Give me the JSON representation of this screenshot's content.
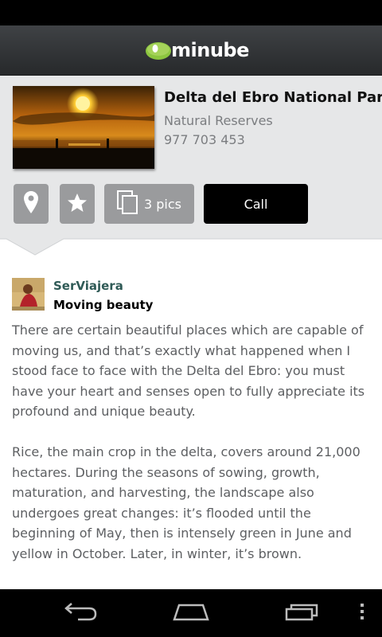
{
  "app": {
    "brand": "minube"
  },
  "place": {
    "name": "Delta del Ebro National Park",
    "category": "Natural Reserves",
    "phone": "977 703 453"
  },
  "actions": {
    "map_icon": "map-pin-icon",
    "favorite_icon": "star-icon",
    "pics_label": "3 pics",
    "call_label": "Call"
  },
  "review": {
    "author": "SerViajera",
    "title": "Moving beauty",
    "paragraphs": [
      "There are certain beautiful places which are capable of moving us, and that’s exactly what happened when I stood face to face with the Delta del Ebro: you must have your heart and senses open to fully appreciate its profound and unique beauty.",
      "Rice, the main crop in the delta, covers around 21,000 hectares. During the seasons of sowing, growth, maturation, and harvesting, the landscape also undergoes great changes: it’s flooded until the beginning of May, then is intensely green in June and yellow in October. Later, in winter, it’s brown."
    ]
  },
  "navigation": {
    "back_icon": "back-icon",
    "home_icon": "home-icon",
    "recents_icon": "recent-apps-icon",
    "menu_icon": "overflow-menu-icon"
  },
  "colors": {
    "brand_green": "#8cc63f",
    "author_color": "#2f5a56",
    "call_button": "#000000",
    "action_button": "#9a9b9d"
  }
}
